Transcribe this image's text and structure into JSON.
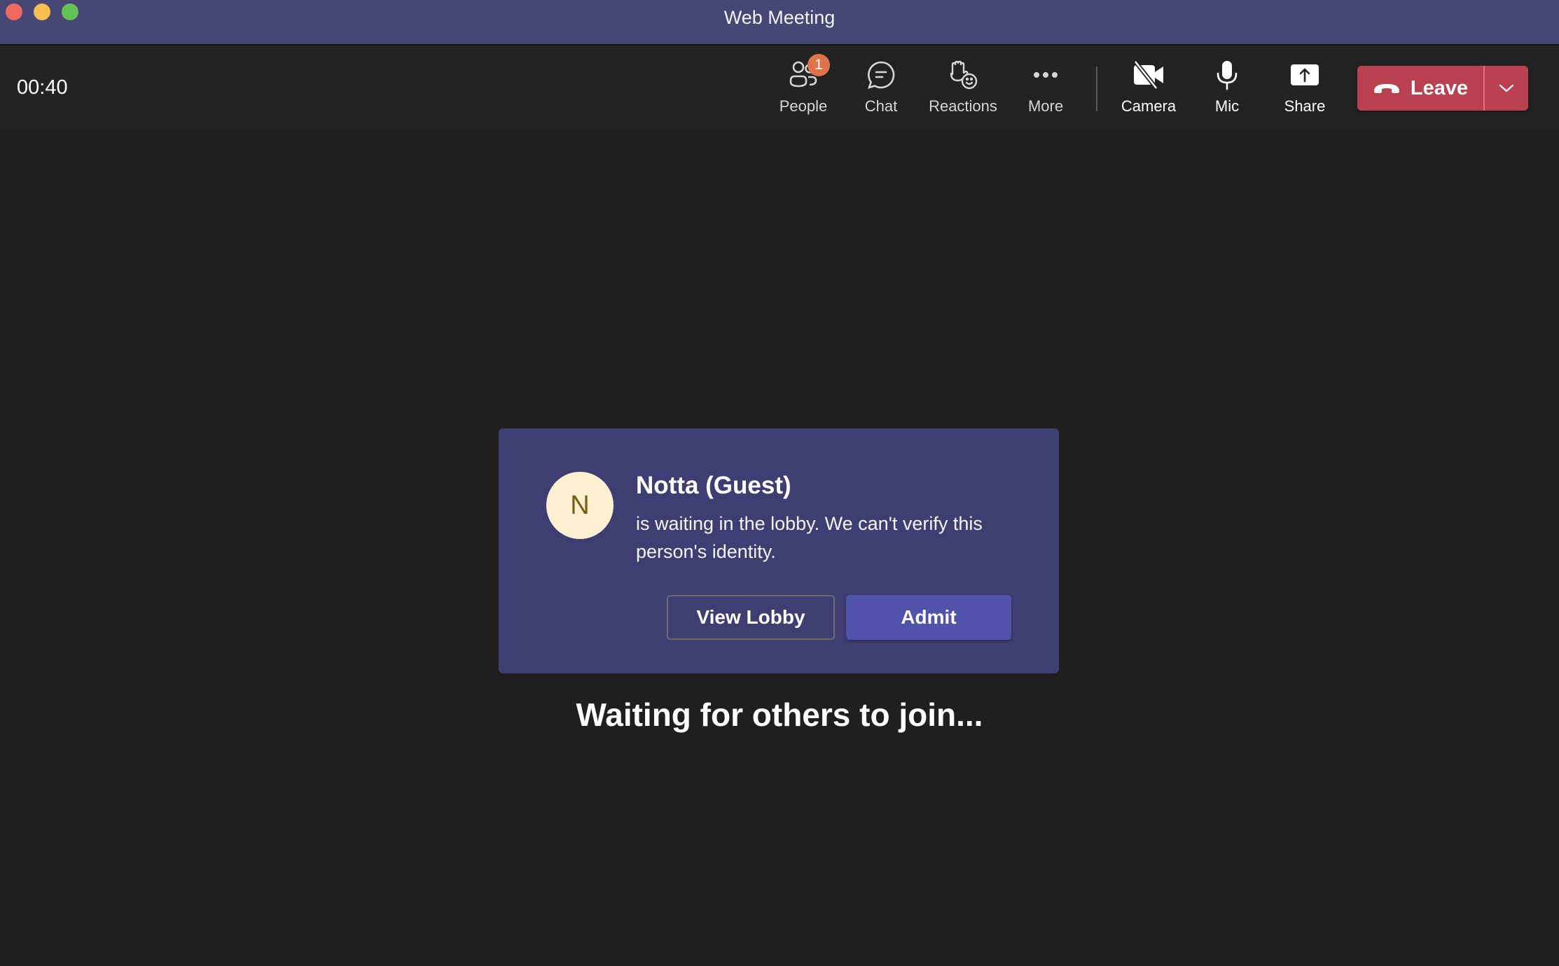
{
  "window": {
    "title": "Web Meeting"
  },
  "toolbar": {
    "timer": "00:40",
    "buttons": [
      {
        "id": "people",
        "label": "People",
        "icon": "people-icon",
        "badge": "1"
      },
      {
        "id": "chat",
        "label": "Chat",
        "icon": "chat-icon"
      },
      {
        "id": "reactions",
        "label": "Reactions",
        "icon": "reactions-icon"
      },
      {
        "id": "more",
        "label": "More",
        "icon": "more-icon"
      },
      {
        "id": "camera",
        "label": "Camera",
        "icon": "camera-off-icon"
      },
      {
        "id": "mic",
        "label": "Mic",
        "icon": "mic-icon"
      },
      {
        "id": "share",
        "label": "Share",
        "icon": "share-icon"
      }
    ],
    "leave": {
      "label": "Leave",
      "icon": "hang-up-icon",
      "dropdown_icon": "chevron-down-icon"
    }
  },
  "lobby_notification": {
    "avatar_initial": "N",
    "name": "Notta (Guest)",
    "message": "is waiting in the lobby. We can't verify this person's identity.",
    "view_lobby_label": "View Lobby",
    "admit_label": "Admit"
  },
  "main": {
    "status": "Waiting for others to join..."
  },
  "colors": {
    "titlebar": "#464775",
    "toolbar": "#232323",
    "background": "#1f1f1f",
    "card": "#3e3e72",
    "admit": "#5152a9",
    "leave": "#b8404f",
    "badge": "#e0734a",
    "avatar": "#fdf0d0"
  }
}
